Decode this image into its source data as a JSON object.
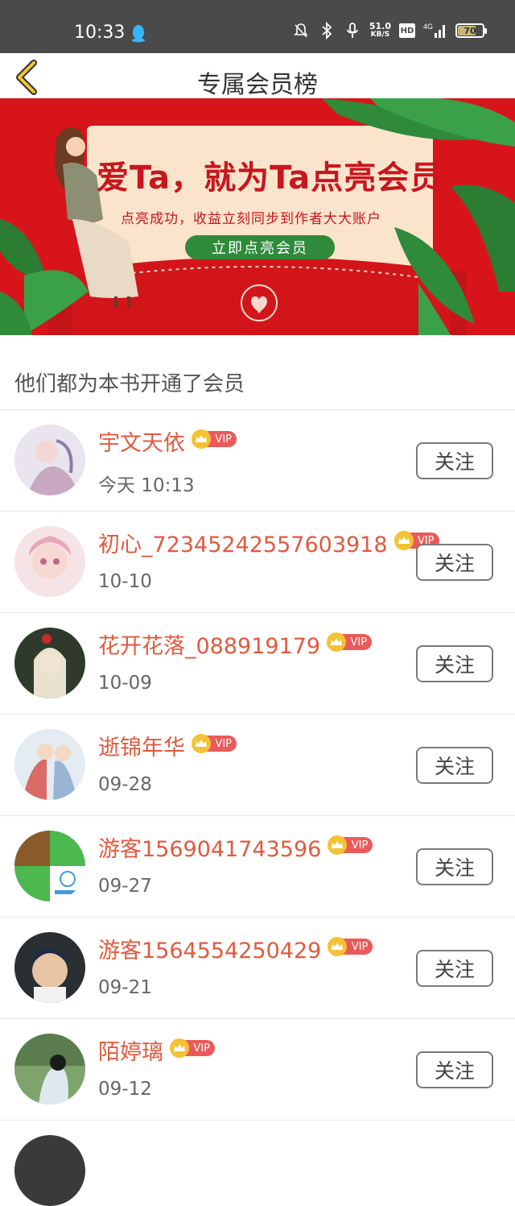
{
  "status_bar": {
    "time": "10:33",
    "net_speed_value": "51.0",
    "net_speed_unit": "KB/S",
    "hd_label": "HD",
    "signal_label": "4G",
    "battery_level": "70"
  },
  "nav": {
    "title": "专属会员榜"
  },
  "banner": {
    "title": "爱Ta，就为Ta点亮会员",
    "subtitle": "点亮成功，收益立刻同步到作者大大账户",
    "button_label": "立即点亮会员"
  },
  "section_title": "他们都为本书开通了会员",
  "vip_label": "VIP",
  "follow_label": "关注",
  "members": [
    {
      "name": "宇文天依",
      "date": "今天 10:13"
    },
    {
      "name": "初心_72345242557603918",
      "date": "10-10"
    },
    {
      "name": "花开花落_088919179",
      "date": "10-09"
    },
    {
      "name": "逝锦年华",
      "date": "09-28"
    },
    {
      "name": "游客1569041743596",
      "date": "09-27"
    },
    {
      "name": "游客1564554250429",
      "date": "09-21"
    },
    {
      "name": "陌婷璃",
      "date": "09-12"
    }
  ]
}
